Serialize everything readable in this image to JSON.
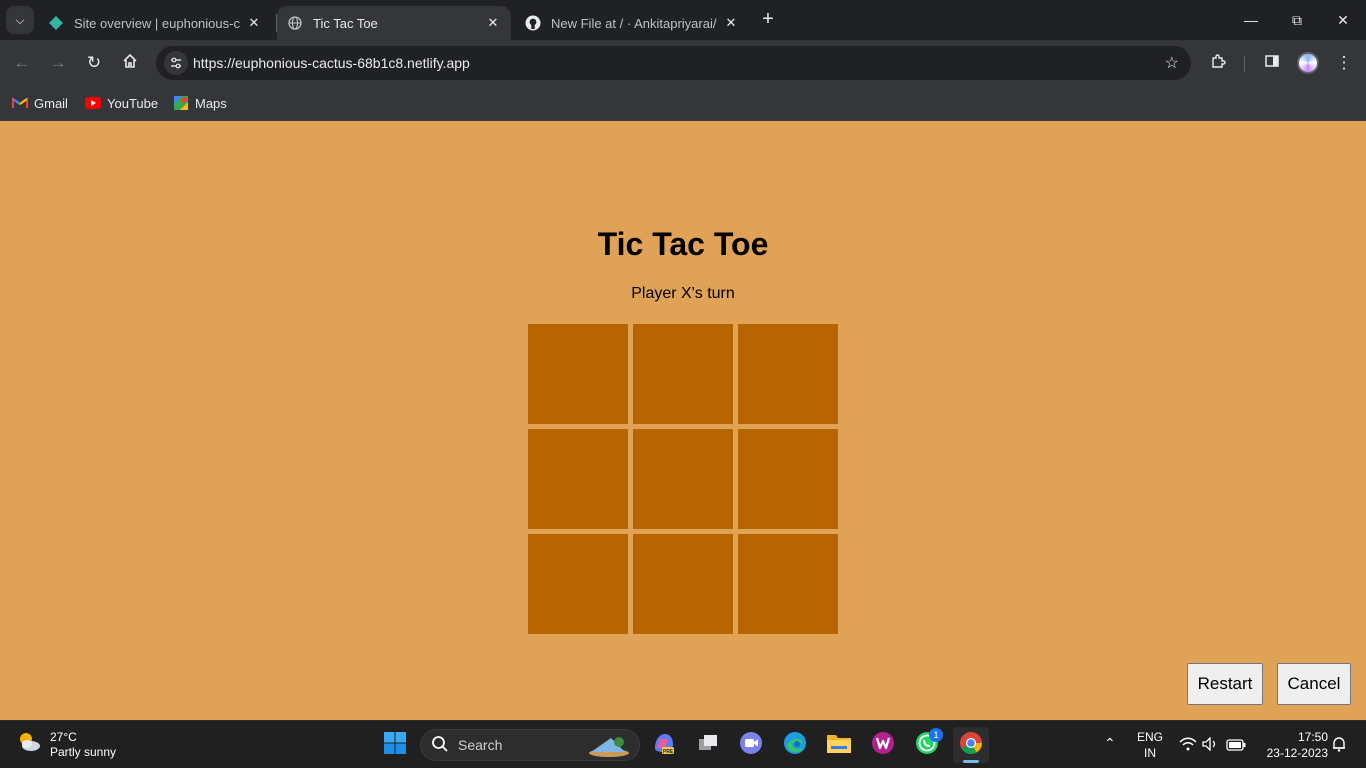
{
  "browser": {
    "tabs": [
      {
        "title": "Site overview | euphonious-cactus",
        "icon": "netlify-icon",
        "active": false
      },
      {
        "title": "Tic Tac Toe",
        "icon": "globe-icon",
        "active": true
      },
      {
        "title": "New File at / · Ankitapriyarai/tic",
        "icon": "github-icon",
        "active": false
      }
    ],
    "address": "https://euphonious-cactus-68b1c8.netlify.app",
    "bookmarks": [
      {
        "label": "Gmail",
        "icon": "gmail-icon"
      },
      {
        "label": "YouTube",
        "icon": "youtube-icon"
      },
      {
        "label": "Maps",
        "icon": "maps-icon"
      }
    ]
  },
  "game": {
    "title": "Tic Tac Toe",
    "status": "Player X's turn",
    "board": [
      "",
      "",
      "",
      "",
      "",
      "",
      "",
      "",
      ""
    ],
    "restart_label": "Restart",
    "cancel_label": "Cancel"
  },
  "taskbar": {
    "weather_temp": "27°C",
    "weather_desc": "Partly sunny",
    "search_label": "Search",
    "whatsapp_badge": "1",
    "lang_primary": "ENG",
    "lang_secondary": "IN",
    "time": "17:50",
    "date": "23-12-2023"
  },
  "colors": {
    "page_bg": "#dfa257",
    "cell": "#b66500"
  }
}
